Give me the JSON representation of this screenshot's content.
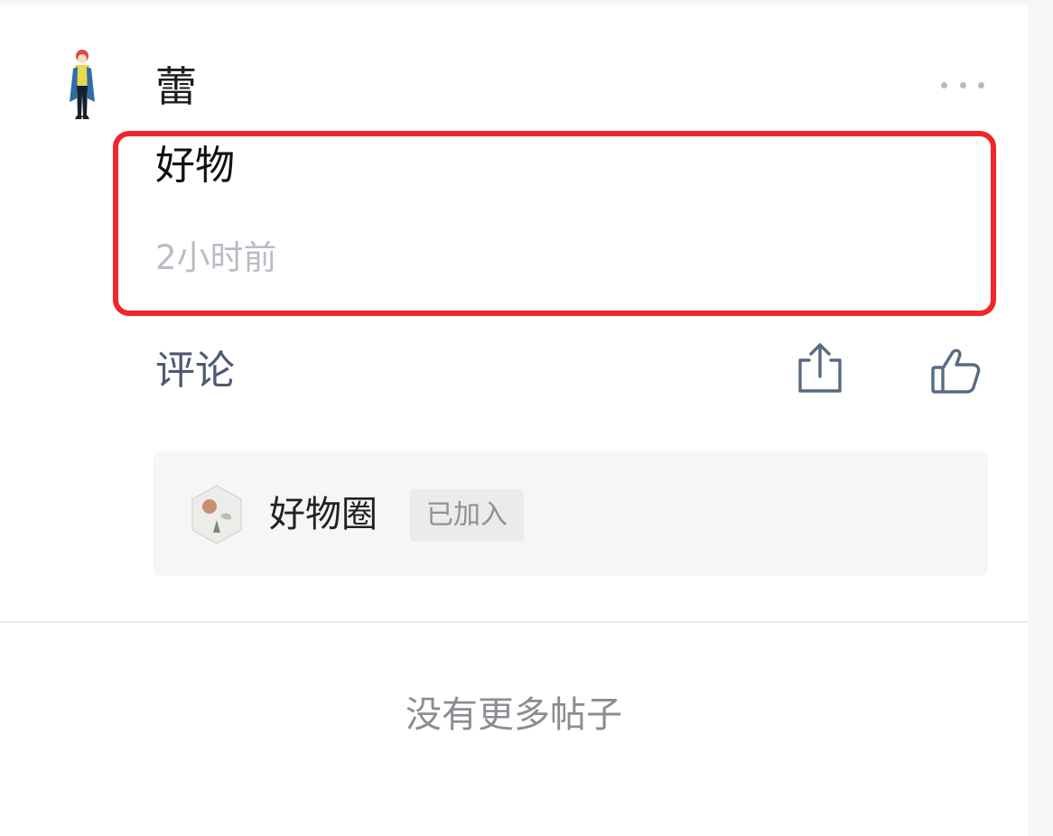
{
  "post": {
    "author": "蕾",
    "text": "好物",
    "time": "2小时前",
    "comment_label": "评论"
  },
  "circle": {
    "name": "好物圈",
    "status": "已加入"
  },
  "footer": {
    "no_more_text": "没有更多帖子"
  },
  "icons": {
    "more": "more-options-icon",
    "share": "share-icon",
    "like": "thumbs-up-icon"
  },
  "colors": {
    "highlight_border": "#f0262b",
    "comment_text": "#4d5a74",
    "secondary_text": "#b8bcc4"
  }
}
